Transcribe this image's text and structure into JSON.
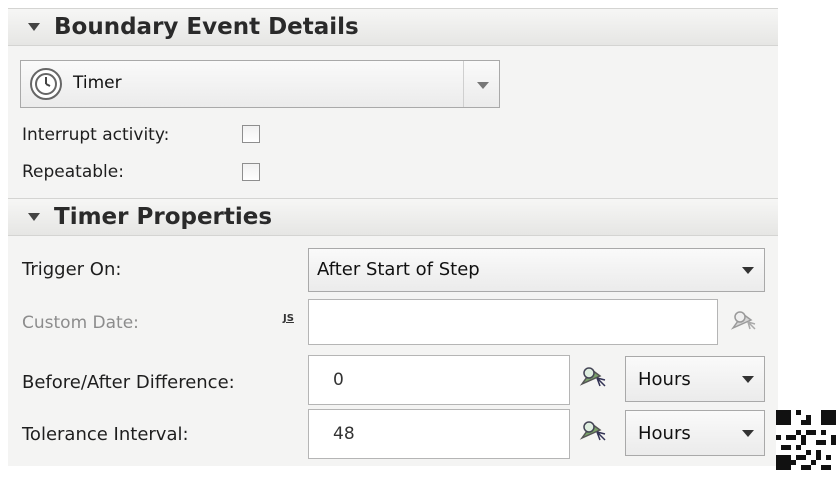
{
  "boundary_section": {
    "title": "Boundary Event Details",
    "event_type": {
      "value": "Timer",
      "icon": "timer-clock-icon"
    },
    "interrupt_activity": {
      "label": "Interrupt activity:",
      "checked": false
    },
    "repeatable": {
      "label": "Repeatable:",
      "checked": false
    }
  },
  "timer_section": {
    "title": "Timer Properties",
    "trigger_on": {
      "label": "Trigger On:",
      "value": "After Start of Step"
    },
    "custom_date": {
      "label": "Custom Date:",
      "js_badge": "JS",
      "value": ""
    },
    "before_after_difference": {
      "label": "Before/After Difference:",
      "value": "0",
      "unit": "Hours"
    },
    "tolerance_interval": {
      "label": "Tolerance Interval:",
      "value": "48",
      "unit": "Hours"
    }
  },
  "icons": {
    "picker": "variable-picker-icon",
    "collapse": "triangle-down-icon",
    "qr": "qr-code-icon"
  }
}
